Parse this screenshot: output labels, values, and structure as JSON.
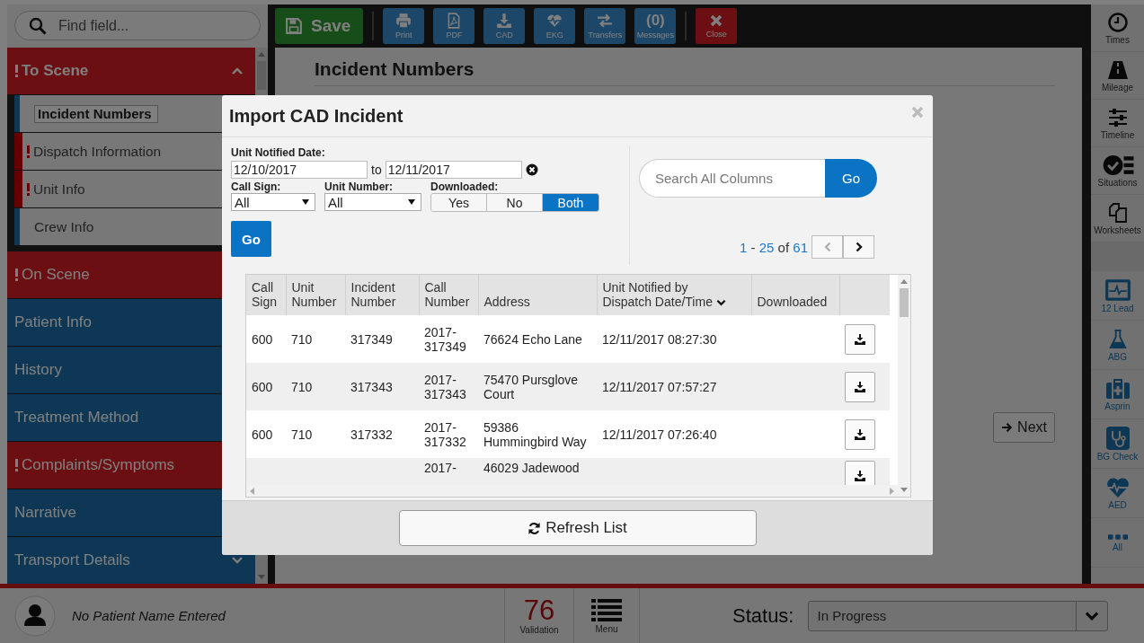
{
  "search": {
    "placeholder": "Find field..."
  },
  "sidebar": {
    "sections": [
      {
        "label": "To Scene",
        "warning": true,
        "expanded": true,
        "items": [
          {
            "label": "Incident Numbers",
            "warning": false,
            "selected": true
          },
          {
            "label": "Dispatch Information",
            "warning": true,
            "selected": false
          },
          {
            "label": "Unit Info",
            "warning": true,
            "selected": false
          },
          {
            "label": "Crew Info",
            "warning": false,
            "selected": false
          }
        ]
      },
      {
        "label": "On Scene",
        "warning": true
      },
      {
        "label": "Patient Info",
        "warning": false
      },
      {
        "label": "History",
        "warning": false
      },
      {
        "label": "Treatment Method",
        "warning": false
      },
      {
        "label": "Complaints/Symptoms",
        "warning": true
      },
      {
        "label": "Narrative",
        "warning": false
      },
      {
        "label": "Transport Details",
        "warning": false,
        "expanded": false
      }
    ]
  },
  "toolbar": {
    "buttons": [
      {
        "kind": "save",
        "label": "Save"
      },
      {
        "kind": "print",
        "label": "Print"
      },
      {
        "kind": "pdf",
        "label": "PDF"
      },
      {
        "kind": "cad",
        "label": "CAD"
      },
      {
        "kind": "ekg",
        "label": "EKG"
      },
      {
        "kind": "transfers",
        "label": "Transfers"
      },
      {
        "kind": "messages",
        "count": "(0)",
        "label": "Messages"
      },
      {
        "kind": "close",
        "label": "Close"
      }
    ]
  },
  "content": {
    "heading": "Incident Numbers",
    "next_button": "Next"
  },
  "rail": {
    "tools": [
      {
        "kind": "times",
        "label": "Times"
      },
      {
        "kind": "mileage",
        "label": "Mileage"
      },
      {
        "kind": "timeline",
        "label": "Timeline"
      },
      {
        "kind": "situations",
        "label": "Situations"
      },
      {
        "kind": "worksheets",
        "label": "Worksheets"
      }
    ],
    "clinical": [
      {
        "kind": "ecg",
        "label": "12 Lead"
      },
      {
        "kind": "abg",
        "label": "ABG"
      },
      {
        "kind": "asprin",
        "label": "Asprin"
      },
      {
        "kind": "bgcheck",
        "label": "BG Check"
      },
      {
        "kind": "aed",
        "label": "AED"
      },
      {
        "kind": "all",
        "label": "All"
      }
    ]
  },
  "modal": {
    "title": "Import CAD Incident",
    "date_label": "Unit Notified Date:",
    "date_from": "12/10/2017",
    "to_label": "to",
    "date_to": "12/11/2017",
    "call_sign": {
      "label": "Call Sign:",
      "value": "All"
    },
    "unit_number": {
      "label": "Unit Number:",
      "value": "All"
    },
    "downloaded": {
      "label": "Downloaded:",
      "options": [
        {
          "label": "Yes",
          "selected": false
        },
        {
          "label": "No",
          "selected": false
        },
        {
          "label": "Both",
          "selected": true
        }
      ]
    },
    "go_button": "Go",
    "search": {
      "placeholder": "Search All Columns",
      "button": "Go"
    },
    "pagination": {
      "start": "1",
      "dash": "-",
      "end": "25",
      "of": "of",
      "total": "61"
    },
    "table": {
      "columns": [
        {
          "label": "Call Sign",
          "sorted": false
        },
        {
          "label": "Unit Number",
          "sorted": false
        },
        {
          "label": "Incident Number",
          "sorted": false
        },
        {
          "label": "Call Number",
          "sorted": false
        },
        {
          "label": "Address",
          "sorted": false
        },
        {
          "label": "Unit Notified by Dispatch Date/Time",
          "sorted": true
        },
        {
          "label": "Downloaded",
          "sorted": false
        }
      ],
      "rows": [
        {
          "call_sign": "600",
          "unit_number": "710",
          "incident_number": "317349",
          "call_number": "2017-317349",
          "address": "76624 Echo Lane",
          "notified": "12/11/2017 08:27:30"
        },
        {
          "call_sign": "600",
          "unit_number": "710",
          "incident_number": "317343",
          "call_number": "2017-317343",
          "address": "75470 Pursglove Court",
          "notified": "12/11/2017 07:57:27"
        },
        {
          "call_sign": "600",
          "unit_number": "710",
          "incident_number": "317332",
          "call_number": "2017-317332",
          "address": "59386 Hummingbird Way",
          "notified": "12/11/2017 07:26:40"
        },
        {
          "call_number": "2017-",
          "address": "46029 Jadewood"
        }
      ]
    },
    "refresh_button": "Refresh List"
  },
  "bottom_bar": {
    "patient": "No Patient Name Entered",
    "validation_count": "76",
    "validation_label": "Validation",
    "menu_label": "Menu",
    "status_label": "Status:",
    "status_value": "In Progress"
  }
}
